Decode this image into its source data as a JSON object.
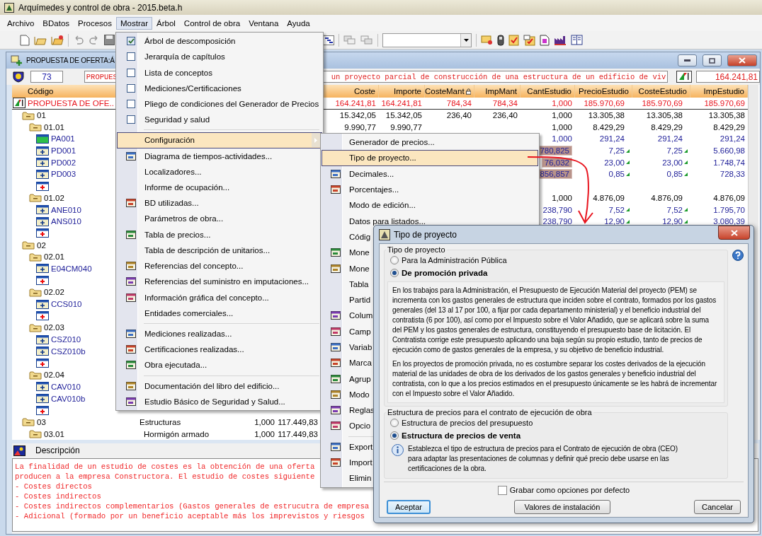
{
  "window": {
    "title": "Arquímedes y control de obra - 2015.beta.h"
  },
  "menu_bar": [
    {
      "label": "Archivo",
      "selected": false
    },
    {
      "label": "BDatos",
      "selected": false
    },
    {
      "label": "Procesos",
      "selected": false
    },
    {
      "label": "Mostrar",
      "selected": true
    },
    {
      "label": "Árbol",
      "selected": false
    },
    {
      "label": "Control de obra",
      "selected": false
    },
    {
      "label": "Ventana",
      "selected": false
    },
    {
      "label": "Ayuda",
      "selected": false
    }
  ],
  "document": {
    "title": "PROPUESTA DE OFERTA:Á",
    "count": "73",
    "summary_start": "PROPUES",
    "summary_end": "un proyecto parcial de construcción de una estructura de un edificio de viv",
    "total": "164.241,81"
  },
  "table": {
    "tree_column": {
      "label": "Código"
    },
    "columns": [
      {},
      {},
      {},
      {
        "label": "Coste"
      },
      {
        "label": "Importe"
      },
      {
        "label": "CosteMant",
        "locked": true
      },
      {
        "label": "ImpMant"
      },
      {
        "label": "CantEstudio"
      },
      {
        "label": "PrecioEstudio"
      },
      {
        "label": "CosteEstudio"
      },
      {
        "label": "ImpEstudio"
      }
    ],
    "rows": [
      {
        "kind": "root",
        "code": "PROPUESTA DE OFE..",
        "cells": [
          null,
          null,
          null,
          "164.241,81",
          "164.241,81",
          "784,34",
          "784,34",
          "1,000",
          "185.970,69",
          "185.970,69",
          "185.970,69"
        ],
        "children": [
          {
            "kind": "chapter",
            "code": "01",
            "cells": [
              null,
              null,
              null,
              "15.342,05",
              "15.342,05",
              "236,40",
              "236,40",
              "1,000",
              "13.305,38",
              "13.305,38",
              "13.305,38"
            ],
            "children": [
              {
                "kind": "chapter",
                "code": "01.01",
                "cells": [
                  null,
                  null,
                  null,
                  "9.990,77",
                  "9.990,77",
                  null,
                  null,
                  "1,000",
                  "8.429,29",
                  "8.429,29",
                  "8.429,29"
                ],
                "children": [
                  {
                    "kind": "lump",
                    "code": "PA001",
                    "cells": [
                      null,
                      null,
                      null,
                      null,
                      null,
                      null,
                      null,
                      "1,000",
                      "291,24",
                      "291,24",
                      "291,24"
                    ]
                  },
                  {
                    "kind": "unit",
                    "code": "PD001",
                    "highlight": true,
                    "flagged": true,
                    "cells": [
                      null,
                      null,
                      null,
                      null,
                      null,
                      null,
                      null,
                      "780,825",
                      "7,25",
                      "7,25",
                      "5.660,98"
                    ]
                  },
                  {
                    "kind": "unit",
                    "code": "PD002",
                    "highlight": true,
                    "flagged": true,
                    "cells": [
                      null,
                      null,
                      null,
                      null,
                      null,
                      null,
                      null,
                      "76,032",
                      "23,00",
                      "23,00",
                      "1.748,74"
                    ]
                  },
                  {
                    "kind": "unit",
                    "code": "PD003",
                    "highlight": true,
                    "flagged": true,
                    "cells": [
                      null,
                      null,
                      null,
                      null,
                      null,
                      null,
                      null,
                      "856,857",
                      "0,85",
                      "0,85",
                      "728,33"
                    ]
                  },
                  {
                    "kind": "new"
                  }
                ]
              },
              {
                "kind": "chapter",
                "code": "01.02",
                "cells": [
                  null,
                  null,
                  null,
                  null,
                  null,
                  null,
                  null,
                  "1,000",
                  "4.876,09",
                  "4.876,09",
                  "4.876,09"
                ],
                "children": [
                  {
                    "kind": "unit",
                    "code": "ANE010",
                    "flagged": true,
                    "cells": [
                      null,
                      null,
                      null,
                      null,
                      null,
                      null,
                      null,
                      "238,790",
                      "7,52",
                      "7,52",
                      "1.795,70"
                    ]
                  },
                  {
                    "kind": "unit",
                    "code": "ANS010",
                    "flagged": true,
                    "cells": [
                      null,
                      null,
                      null,
                      null,
                      null,
                      null,
                      null,
                      "238,790",
                      "12,90",
                      "12,90",
                      "3.080,39"
                    ]
                  },
                  {
                    "kind": "new"
                  }
                ]
              }
            ]
          },
          {
            "kind": "chapter",
            "code": "02",
            "children": [
              {
                "kind": "chapter",
                "code": "02.01",
                "children": [
                  {
                    "kind": "unit",
                    "code": "E04CM040"
                  },
                  {
                    "kind": "new"
                  }
                ]
              },
              {
                "kind": "chapter",
                "code": "02.02",
                "children": [
                  {
                    "kind": "unit",
                    "code": "CCS010"
                  },
                  {
                    "kind": "new"
                  }
                ]
              },
              {
                "kind": "chapter",
                "code": "02.03",
                "children": [
                  {
                    "kind": "unit",
                    "code": "CSZ010"
                  },
                  {
                    "kind": "unit",
                    "code": "CSZ010b"
                  },
                  {
                    "kind": "new"
                  }
                ]
              },
              {
                "kind": "chapter",
                "code": "02.04",
                "children": [
                  {
                    "kind": "unit",
                    "code": "CAV010"
                  },
                  {
                    "kind": "unit",
                    "code": "CAV010b"
                  },
                  {
                    "kind": "new"
                  }
                ]
              }
            ]
          },
          {
            "kind": "chapter",
            "code": "03",
            "cells": [
              "Estructuras",
              "1,000",
              "117.449,83"
            ],
            "children": [
              {
                "kind": "chapter",
                "code": "03.01",
                "cells": [
                  "Hormigón armado",
                  "1,000",
                  "117.449,83"
                ]
              }
            ]
          }
        ]
      }
    ]
  },
  "description": {
    "title": "Descripción",
    "lines": [
      "La finalidad de un estudio de costes es la obtención de una oferta",
      "producen a la empresa Constructora. El estudio de costes siguiente",
      "- Costes directos",
      "- Costes indirectos",
      "- Costes indirectos complementarios (Gastos generales de estrucutra de empresa",
      "- Adicional (formado por un beneficio aceptable más los imprevistos y riesgos"
    ]
  },
  "mostrar_menu": {
    "items": [
      {
        "kind": "check",
        "label": "Árbol de descomposición",
        "checked": true,
        "selected": false
      },
      {
        "kind": "check",
        "label": "Jerarquía de capítulos",
        "checked": false,
        "selected": false
      },
      {
        "kind": "check",
        "label": "Lista de conceptos",
        "checked": false,
        "selected": false
      },
      {
        "kind": "check",
        "label": "Mediciones/Certificaciones",
        "checked": false,
        "selected": false
      },
      {
        "kind": "check",
        "label": "Pliego de condiciones del Generador de Precios",
        "checked": false,
        "selected": false
      },
      {
        "kind": "check",
        "label": "Seguridad y salud",
        "checked": false,
        "selected": false
      },
      {
        "kind": "separator"
      },
      {
        "kind": "submenu",
        "label": "Configuración",
        "selected": true
      },
      {
        "kind": "icon",
        "label": "Diagrama de tiempos-actividades...",
        "selected": false
      },
      {
        "kind": "plain",
        "label": "Localizadores...",
        "selected": false
      },
      {
        "kind": "plain",
        "label": "Informe de ocupación...",
        "selected": false
      },
      {
        "kind": "icon",
        "label": "BD utilizadas...",
        "selected": false
      },
      {
        "kind": "plain",
        "label": "Parámetros de obra...",
        "selected": false
      },
      {
        "kind": "icon",
        "label": "Tabla de precios...",
        "selected": false
      },
      {
        "kind": "plain",
        "label": "Tabla de descripción de unitarios...",
        "selected": false
      },
      {
        "kind": "icon",
        "label": "Referencias del concepto...",
        "selected": false
      },
      {
        "kind": "icon",
        "label": "Referencias del suministro en imputaciones...",
        "selected": false
      },
      {
        "kind": "icon",
        "label": "Información gráfica del concepto...",
        "selected": false
      },
      {
        "kind": "plain",
        "label": "Entidades comerciales...",
        "selected": false
      },
      {
        "kind": "separator"
      },
      {
        "kind": "icon",
        "label": "Mediciones realizadas...",
        "selected": false
      },
      {
        "kind": "icon",
        "label": "Certificaciones realizadas...",
        "selected": false
      },
      {
        "kind": "icon",
        "label": "Obra ejecutada...",
        "selected": false
      },
      {
        "kind": "separator"
      },
      {
        "kind": "icon",
        "label": "Documentación del libro del edificio...",
        "selected": false
      },
      {
        "kind": "icon",
        "label": "Estudio Básico de Seguridad y Salud...",
        "selected": false
      }
    ]
  },
  "configuracion_submenu": {
    "items": [
      {
        "kind": "plain",
        "label": "Generador de precios...",
        "selected": false
      },
      {
        "kind": "plain",
        "label": "Tipo de proyecto...",
        "selected": true
      },
      {
        "kind": "icon",
        "label": "Decimales...",
        "selected": false
      },
      {
        "kind": "icon",
        "label": "Porcentajes...",
        "selected": false
      },
      {
        "kind": "plain",
        "label": "Modo de edición...",
        "selected": false
      },
      {
        "kind": "plain",
        "label": "Datos para listados...",
        "selected": false
      },
      {
        "kind": "plain",
        "label": "Códig",
        "selected": false
      },
      {
        "kind": "icon",
        "label": "Mone",
        "selected": false
      },
      {
        "kind": "icon",
        "label": "Mone",
        "selected": false
      },
      {
        "kind": "plain",
        "label": "Tabla",
        "selected": false
      },
      {
        "kind": "plain",
        "label": "Partid",
        "selected": false
      },
      {
        "kind": "icon",
        "label": "Colum",
        "selected": false
      },
      {
        "kind": "icon",
        "label": "Camp",
        "selected": false
      },
      {
        "kind": "icon",
        "label": "Variab",
        "selected": false
      },
      {
        "kind": "icon",
        "label": "Marca",
        "selected": false
      },
      {
        "kind": "icon",
        "label": "Agrup",
        "selected": false
      },
      {
        "kind": "icon",
        "label": "Modo",
        "selected": false
      },
      {
        "kind": "icon",
        "label": "Reglas",
        "selected": false
      },
      {
        "kind": "icon",
        "label": "Opcio",
        "selected": false
      },
      {
        "kind": "separator"
      },
      {
        "kind": "icon",
        "label": "Export",
        "selected": false
      },
      {
        "kind": "icon",
        "label": "Import",
        "selected": false
      },
      {
        "kind": "plain",
        "label": "Elimin",
        "selected": false
      }
    ]
  },
  "dialog": {
    "title": "Tipo de proyecto",
    "project_type": {
      "legend": "Tipo de proyecto",
      "options": [
        {
          "label": "Para la Administración Pública",
          "selected": false
        },
        {
          "label": "De promoción privada",
          "selected": true
        }
      ],
      "info": [
        "En los trabajos para la Administración, el Presupuesto de Ejecución Material del proyecto (PEM) se incrementa con los gastos generales de estructura que inciden sobre el contrato, formados por los gastos generales (del 13 al 17 por 100, a fijar por cada departamento ministerial) y el beneficio industrial del contratista (6 por 100), así como por el Impuesto sobre el Valor Añadido, que se aplicará sobre la suma del PEM y los gastos generales de estructura, constituyendo el presupuesto base de licitación. El Contratista corrige este presupuesto aplicando una baja según su propio estudio, tanto de precios de ejecución como de gastos generales de la empresa, y su objetivo de beneficio industrial.",
        "En los proyectos de promoción privada, no es costumbre separar los costes derivados de la ejecución material de las unidades de obra de los derivados de los gastos generales y beneficio industrial del contratista, con lo que a los precios estimados en el presupuesto únicamente se les habrá de incrementar con el Impuesto sobre el Valor Añadido."
      ]
    },
    "price_structure": {
      "legend": "Estructura de precios para el contrato de ejecución de obra",
      "options": [
        {
          "label": "Estructura de precios del presupuesto",
          "selected": false
        },
        {
          "label": "Estructura de precios de venta",
          "selected": true
        }
      ],
      "note": "Establezca el tipo de estructura de precios para el Contrato de ejecución de obra (CEO) para adaptar las presentaciones de columnas y definir qué precio debe usarse en las certificaciones de la obra."
    },
    "save_default": {
      "label": "Grabar como opciones por defecto",
      "checked": false
    },
    "buttons": [
      {
        "label": "Aceptar",
        "focused": true
      },
      {
        "label": "Valores de instalación",
        "focused": false
      },
      {
        "label": "Cancelar",
        "focused": false
      }
    ]
  }
}
